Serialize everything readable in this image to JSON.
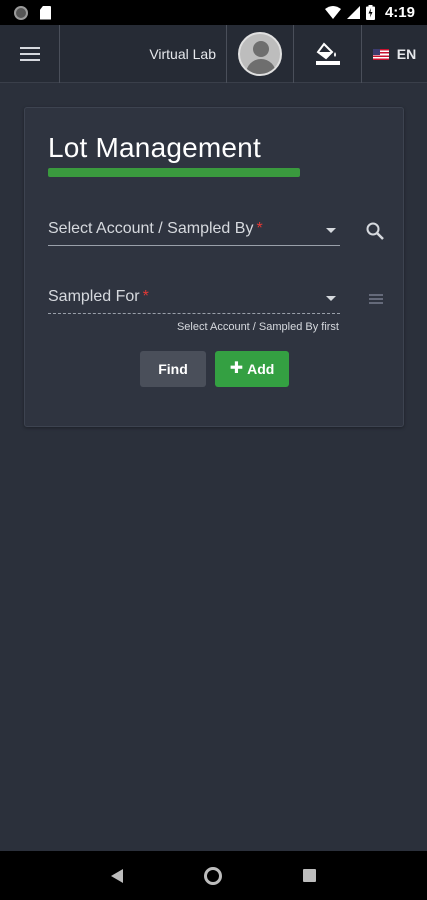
{
  "status_bar": {
    "time": "4:19",
    "icons": [
      "notification-dot-icon",
      "sd-card-icon",
      "wifi-icon",
      "signal-icon",
      "battery-charging-icon"
    ]
  },
  "header": {
    "menu_icon": "hamburger-menu-icon",
    "brand": "Virtual Lab",
    "avatar_icon": "user-avatar-icon",
    "theme_icon": "paint-bucket-icon",
    "language_flag": "us-flag-icon",
    "language": "EN"
  },
  "card": {
    "title": "Lot Management",
    "accent_color": "#3a9a3e",
    "fields": [
      {
        "label": "Select Account / Sampled By",
        "required": "*",
        "icon": "search-icon"
      },
      {
        "label": "Sampled For",
        "required": "*",
        "icon": "list-icon"
      }
    ],
    "hint": "Select Account / Sampled By first",
    "buttons": {
      "find": "Find",
      "add": "Add",
      "add_icon": "plus-icon"
    }
  },
  "nav_bar": {
    "icons": [
      "back-icon",
      "home-icon",
      "recent-apps-icon"
    ]
  },
  "colors": {
    "background": "#2b303b",
    "card": "#2f3440",
    "primary_green": "#34a042",
    "required": "#e53935"
  }
}
